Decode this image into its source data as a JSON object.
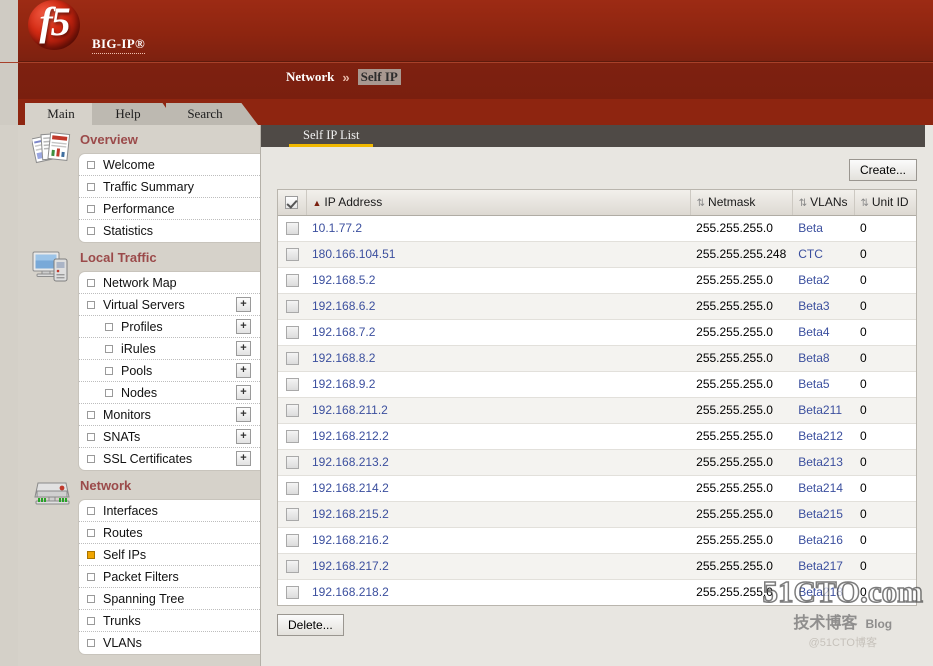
{
  "banner": {
    "logo_text": "f5",
    "product_label": "BIG-IP®"
  },
  "breadcrumb": {
    "root": "Network",
    "separator": "»",
    "current": "Self IP"
  },
  "top_tabs": [
    {
      "label": "Main",
      "active": true
    },
    {
      "label": "Help",
      "active": false
    },
    {
      "label": "Search",
      "active": false
    }
  ],
  "sidebar": {
    "sections": [
      {
        "title": "Overview",
        "icon": "reports-icon",
        "items": [
          {
            "label": "Welcome",
            "indent": false,
            "expandable": false,
            "active": false
          },
          {
            "label": "Traffic Summary",
            "indent": false,
            "expandable": false,
            "active": false
          },
          {
            "label": "Performance",
            "indent": false,
            "expandable": false,
            "active": false
          },
          {
            "label": "Statistics",
            "indent": false,
            "expandable": false,
            "active": false
          }
        ]
      },
      {
        "title": "Local Traffic",
        "icon": "local-traffic-icon",
        "items": [
          {
            "label": "Network Map",
            "indent": false,
            "expandable": false,
            "active": false
          },
          {
            "label": "Virtual Servers",
            "indent": false,
            "expandable": true,
            "active": false
          },
          {
            "label": "Profiles",
            "indent": true,
            "expandable": true,
            "active": false
          },
          {
            "label": "iRules",
            "indent": true,
            "expandable": true,
            "active": false
          },
          {
            "label": "Pools",
            "indent": true,
            "expandable": true,
            "active": false
          },
          {
            "label": "Nodes",
            "indent": true,
            "expandable": true,
            "active": false
          },
          {
            "label": "Monitors",
            "indent": false,
            "expandable": true,
            "active": false
          },
          {
            "label": "SNATs",
            "indent": false,
            "expandable": true,
            "active": false
          },
          {
            "label": "SSL Certificates",
            "indent": false,
            "expandable": true,
            "active": false
          }
        ]
      },
      {
        "title": "Network",
        "icon": "network-device-icon",
        "items": [
          {
            "label": "Interfaces",
            "indent": false,
            "expandable": false,
            "active": false
          },
          {
            "label": "Routes",
            "indent": false,
            "expandable": false,
            "active": false
          },
          {
            "label": "Self IPs",
            "indent": false,
            "expandable": false,
            "active": true
          },
          {
            "label": "Packet Filters",
            "indent": false,
            "expandable": false,
            "active": false
          },
          {
            "label": "Spanning Tree",
            "indent": false,
            "expandable": false,
            "active": false
          },
          {
            "label": "Trunks",
            "indent": false,
            "expandable": false,
            "active": false
          },
          {
            "label": "VLANs",
            "indent": false,
            "expandable": false,
            "active": false
          }
        ]
      }
    ],
    "expand_glyph": "+"
  },
  "content": {
    "tab_label": "Self IP List",
    "create_button": "Create...",
    "delete_button": "Delete...",
    "select_all_checked": true,
    "sort_glyph_active": "▲",
    "sort_glyph_idle": "⇅",
    "columns": [
      {
        "key": "ip",
        "label": "IP Address",
        "sorted": true
      },
      {
        "key": "netmask",
        "label": "Netmask",
        "sorted": false
      },
      {
        "key": "vlans",
        "label": "VLANs",
        "sorted": false
      },
      {
        "key": "unit",
        "label": "Unit ID",
        "sorted": false
      }
    ],
    "rows": [
      {
        "ip": "10.1.77.2",
        "netmask": "255.255.255.0",
        "vlans": "Beta",
        "unit": "0",
        "checked": false
      },
      {
        "ip": "180.166.104.51",
        "netmask": "255.255.255.248",
        "vlans": "CTC",
        "unit": "0",
        "checked": false
      },
      {
        "ip": "192.168.5.2",
        "netmask": "255.255.255.0",
        "vlans": "Beta2",
        "unit": "0",
        "checked": false
      },
      {
        "ip": "192.168.6.2",
        "netmask": "255.255.255.0",
        "vlans": "Beta3",
        "unit": "0",
        "checked": false
      },
      {
        "ip": "192.168.7.2",
        "netmask": "255.255.255.0",
        "vlans": "Beta4",
        "unit": "0",
        "checked": false
      },
      {
        "ip": "192.168.8.2",
        "netmask": "255.255.255.0",
        "vlans": "Beta8",
        "unit": "0",
        "checked": false
      },
      {
        "ip": "192.168.9.2",
        "netmask": "255.255.255.0",
        "vlans": "Beta5",
        "unit": "0",
        "checked": false
      },
      {
        "ip": "192.168.211.2",
        "netmask": "255.255.255.0",
        "vlans": "Beta211",
        "unit": "0",
        "checked": false
      },
      {
        "ip": "192.168.212.2",
        "netmask": "255.255.255.0",
        "vlans": "Beta212",
        "unit": "0",
        "checked": false
      },
      {
        "ip": "192.168.213.2",
        "netmask": "255.255.255.0",
        "vlans": "Beta213",
        "unit": "0",
        "checked": false
      },
      {
        "ip": "192.168.214.2",
        "netmask": "255.255.255.0",
        "vlans": "Beta214",
        "unit": "0",
        "checked": false
      },
      {
        "ip": "192.168.215.2",
        "netmask": "255.255.255.0",
        "vlans": "Beta215",
        "unit": "0",
        "checked": false
      },
      {
        "ip": "192.168.216.2",
        "netmask": "255.255.255.0",
        "vlans": "Beta216",
        "unit": "0",
        "checked": false
      },
      {
        "ip": "192.168.217.2",
        "netmask": "255.255.255.0",
        "vlans": "Beta217",
        "unit": "0",
        "checked": false
      },
      {
        "ip": "192.168.218.2",
        "netmask": "255.255.255.0",
        "vlans": "Beta218",
        "unit": "0",
        "checked": false
      }
    ]
  },
  "watermark": {
    "main": "51CTO.com",
    "sub": "技术博客",
    "blog": "Blog",
    "tiny": "@51CTO博客"
  },
  "colors": {
    "brand_red": "#8e2510",
    "accent_yellow": "#f0b800",
    "link_blue": "#3b4f9e",
    "section_heading": "#9b4a4a"
  }
}
